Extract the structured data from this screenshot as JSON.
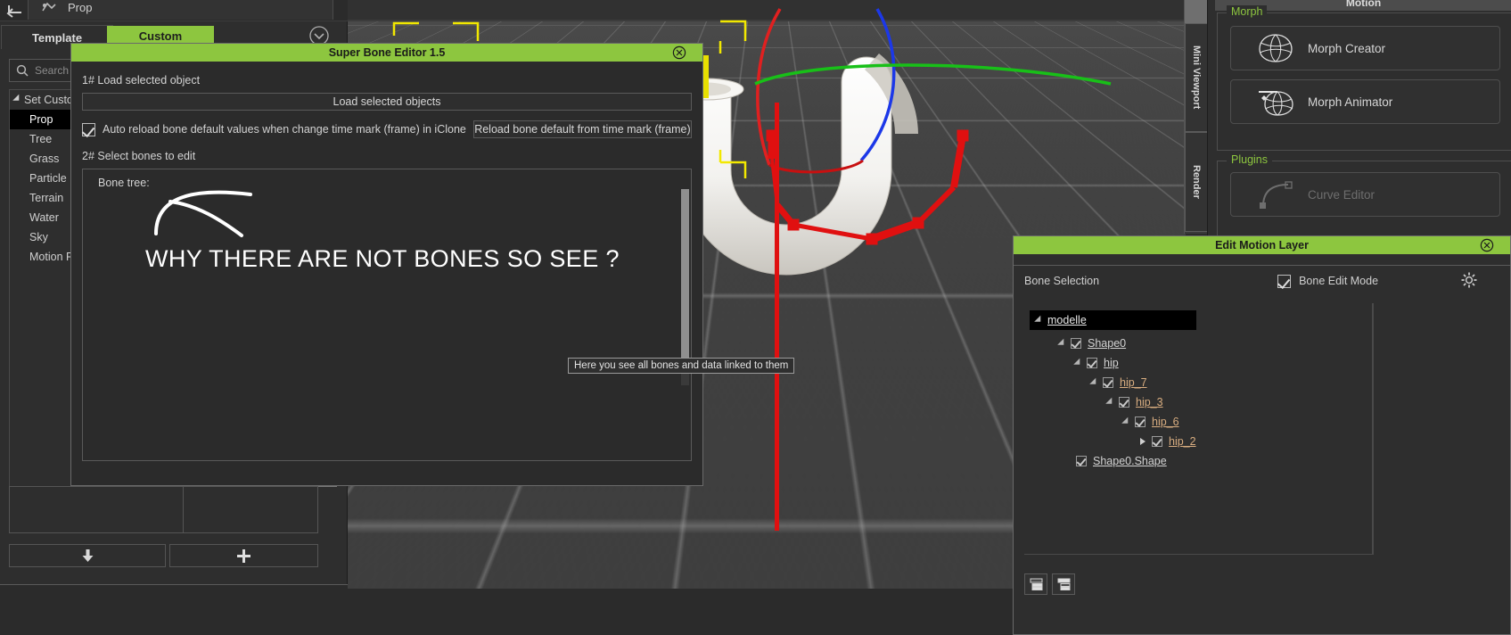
{
  "app": {
    "left_panel": {
      "back_icon": "back-arrow-icon",
      "prop_tab_label": "Prop",
      "prop_tab_icon": "prop-icon",
      "template_tab_label": "Template",
      "custom_tab_label": "Custom",
      "chevron_icon": "chevron-down-icon",
      "search_placeholder": "Search",
      "search_icon": "search-icon",
      "tree_root_label": "Set Custom",
      "tree_items": [
        {
          "label": "Prop",
          "selected": true
        },
        {
          "label": "Tree",
          "selected": false
        },
        {
          "label": "Grass",
          "selected": false
        },
        {
          "label": "Particle",
          "selected": false
        },
        {
          "label": "Terrain",
          "selected": false
        },
        {
          "label": "Water",
          "selected": false
        },
        {
          "label": "Sky",
          "selected": false
        },
        {
          "label": "Motion P",
          "selected": false
        }
      ],
      "download_button_icon": "download-arrow-icon",
      "add_button_icon": "plus-icon"
    },
    "super_bone_editor": {
      "title": "Super Bone Editor 1.5",
      "close_icon": "close-circle-icon",
      "step1_label": "1# Load selected object",
      "load_button_label": "Load selected objects",
      "auto_reload_checked": true,
      "auto_reload_label": "Auto reload bone default values when change time mark (frame) in iClone",
      "reload_button_label": "Reload bone default from time mark (frame)",
      "step2_label": "2# Select bones to edit",
      "bone_tree_label": "Bone tree:",
      "annotation_text": "WHY THERE ARE NOT BONES SO SEE ?",
      "annotation_arrow_icon": "curved-arrow-icon"
    },
    "tooltip": {
      "text": "Here you see all bones and data linked to them"
    },
    "viewport": {
      "dock_tabs": [
        "Mini Viewport",
        "Render"
      ],
      "gizmo_axis_colors": {
        "x": "#e02020",
        "y": "#18c018",
        "z": "#1c38e8"
      },
      "bone_chain_color": "#e01010",
      "selection_bracket_color": "#f2e800"
    },
    "right_panel": {
      "motion_tab_label": "Motion",
      "groups": [
        {
          "title": "Morph",
          "buttons": [
            {
              "label": "Morph Creator",
              "icon": "morph-creator-icon",
              "disabled": false
            },
            {
              "label": "Morph Animator",
              "icon": "morph-animator-icon",
              "disabled": false
            }
          ]
        },
        {
          "title": "Plugins",
          "buttons": [
            {
              "label": "Curve Editor",
              "icon": "curve-editor-icon",
              "disabled": true
            }
          ]
        }
      ]
    },
    "edit_motion_layer": {
      "title": "Edit Motion Layer",
      "close_icon": "close-circle-icon",
      "bone_selection_label": "Bone Selection",
      "bone_edit_mode_label": "Bone Edit Mode",
      "bone_edit_mode_checked": true,
      "settings_icon": "gear-icon",
      "tree": [
        {
          "label": "modelle",
          "depth": 0,
          "expander": "down",
          "checkbox": false,
          "selected": true,
          "highlight": false
        },
        {
          "label": "Shape0",
          "depth": 1,
          "expander": "down",
          "checkbox": true,
          "selected": false,
          "highlight": false
        },
        {
          "label": "hip",
          "depth": 2,
          "expander": "down",
          "checkbox": true,
          "selected": false,
          "highlight": false
        },
        {
          "label": "hip_7",
          "depth": 3,
          "expander": "down",
          "checkbox": true,
          "selected": false,
          "highlight": true
        },
        {
          "label": "hip_3",
          "depth": 4,
          "expander": "down",
          "checkbox": true,
          "selected": false,
          "highlight": true
        },
        {
          "label": "hip_6",
          "depth": 5,
          "expander": "down",
          "checkbox": true,
          "selected": false,
          "highlight": true
        },
        {
          "label": "hip_2",
          "depth": 6,
          "expander": "right",
          "checkbox": true,
          "selected": false,
          "highlight": true
        },
        {
          "label": "Shape0.Shape",
          "depth": 2,
          "expander": "none",
          "checkbox": true,
          "selected": false,
          "highlight": false
        }
      ],
      "tools": [
        {
          "icon": "list-view-icon"
        },
        {
          "icon": "tree-view-icon"
        }
      ]
    }
  }
}
